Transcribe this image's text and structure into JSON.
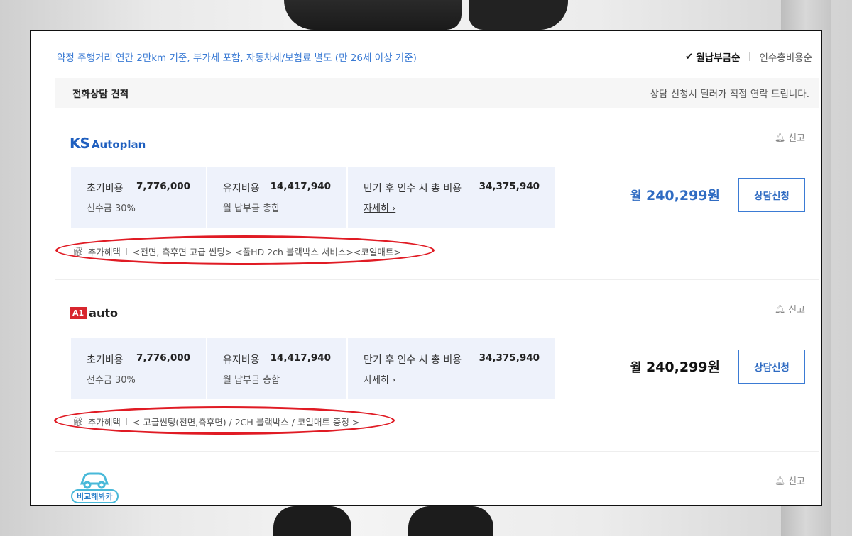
{
  "header": {
    "notice": "약정 주행거리 연간 2만km 기준, 부가세 포함, 자동차세/보험료 별도 (만 26세 이상 기준)",
    "sort_active": "월납부금순",
    "sort_other": "인수총비용순"
  },
  "section": {
    "title": "전화상담 견적",
    "desc": "상담 신청시 딜러가 직접 연락 드립니다."
  },
  "dealers": [
    {
      "logo_text": "Autoplan",
      "logo_mark": "KS",
      "report": "신고",
      "initial_label": "초기비용",
      "initial_value": "7,776,000",
      "initial_sub": "선수금 30%",
      "maint_label": "유지비용",
      "maint_value": "14,417,940",
      "maint_sub": "월 납부금 총합",
      "total_label": "만기 후 인수 시 총 비용",
      "total_value": "34,375,940",
      "detail": "자세히 ›",
      "price_prefix": "월",
      "price": "240,299원",
      "price_color": "#2f6bc2",
      "cta": "상담신청",
      "benefit_label": "추가혜택",
      "benefit_text": "<전면, 측후면 고급 썬팅> <풀HD 2ch 블랙박스 서비스><코일매트>"
    },
    {
      "logo_text": "auto",
      "logo_mark": "A1",
      "report": "신고",
      "initial_label": "초기비용",
      "initial_value": "7,776,000",
      "initial_sub": "선수금 30%",
      "maint_label": "유지비용",
      "maint_value": "14,417,940",
      "maint_sub": "월 납부금 총합",
      "total_label": "만기 후 인수 시 총 비용",
      "total_value": "34,375,940",
      "detail": "자세히 ›",
      "price_prefix": "월",
      "price": "240,299원",
      "price_color": "#111111",
      "cta": "상담신청",
      "benefit_label": "추가혜택",
      "benefit_text": "< 고급썬팅(전면,측후면) / 2CH 블랙박스 / 코일매트 증정 >"
    },
    {
      "logo_text": "비교해봐카",
      "report": "신고"
    }
  ],
  "colors": {
    "accent": "#3b7bd4",
    "highlight": "#e01b24",
    "cell_bg": "#eef2fb"
  }
}
